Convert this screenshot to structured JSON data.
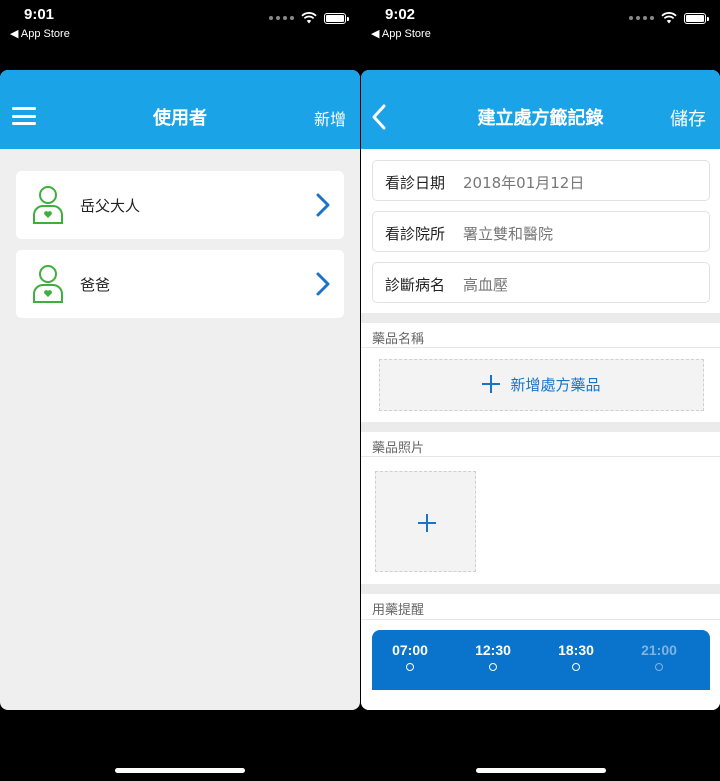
{
  "left": {
    "status": {
      "time": "9:01",
      "back_label": "◀ App Store"
    },
    "nav": {
      "title": "使用者",
      "add_label": "新增"
    },
    "users": [
      {
        "name": "岳父大人"
      },
      {
        "name": "爸爸"
      }
    ]
  },
  "right": {
    "status": {
      "time": "9:02",
      "back_label": "◀ App Store"
    },
    "nav": {
      "title": "建立處方籤記錄",
      "save_label": "儲存"
    },
    "fields": [
      {
        "label": "看診日期",
        "value": "2018年01月12日"
      },
      {
        "label": "看診院所",
        "value": "署立雙和醫院"
      },
      {
        "label": "診斷病名",
        "value": "高血壓"
      }
    ],
    "sections": {
      "medicine_name": "藥品名稱",
      "add_medicine": "新增處方藥品",
      "medicine_photo": "藥品照片",
      "reminder": "用藥提醒"
    },
    "times": [
      "07:00",
      "12:30",
      "18:30",
      "21:00"
    ]
  },
  "colors": {
    "accent": "#1ba3e8",
    "action_blue": "#1a73c8",
    "avatar_green": "#3fae3f",
    "time_bar": "#0a74cc"
  },
  "icons": [
    "menu-icon",
    "person-heart-icon",
    "chevron-right-icon",
    "back-chevron-icon",
    "plus-icon",
    "wifi-icon",
    "battery-icon"
  ]
}
